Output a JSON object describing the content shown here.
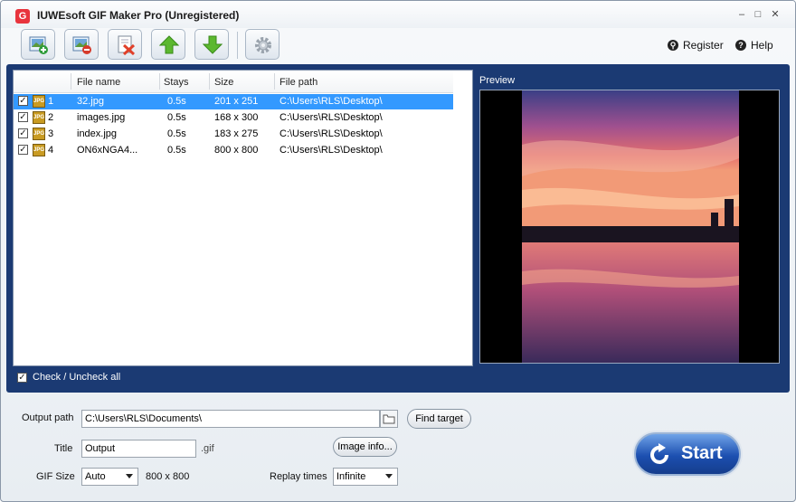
{
  "window": {
    "title": "IUWEsoft GIF Maker Pro (Unregistered)",
    "app_icon_letter": "G",
    "controls": [
      "–",
      "□",
      "✕"
    ]
  },
  "toolbar": {
    "buttons": [
      {
        "name": "add-image-button",
        "icon": "add-image-icon"
      },
      {
        "name": "remove-image-button",
        "icon": "remove-image-icon"
      },
      {
        "name": "clear-list-button",
        "icon": "delete-document-icon"
      },
      {
        "name": "move-up-button",
        "icon": "arrow-up-icon"
      },
      {
        "name": "move-down-button",
        "icon": "arrow-down-icon"
      },
      {
        "name": "settings-button",
        "icon": "gear-icon"
      }
    ],
    "register_label": "Register",
    "help_label": "Help"
  },
  "file_list": {
    "columns": [
      "File name",
      "Stays",
      "Size",
      "File path"
    ],
    "rows": [
      {
        "index": "1",
        "name": "32.jpg",
        "stays": "0.5s",
        "size": "201 x 251",
        "path": "C:\\Users\\RLS\\Desktop\\",
        "checked": true,
        "selected": true
      },
      {
        "index": "2",
        "name": "images.jpg",
        "stays": "0.5s",
        "size": "168 x 300",
        "path": "C:\\Users\\RLS\\Desktop\\",
        "checked": true,
        "selected": false
      },
      {
        "index": "3",
        "name": "index.jpg",
        "stays": "0.5s",
        "size": "183 x 275",
        "path": "C:\\Users\\RLS\\Desktop\\",
        "checked": true,
        "selected": false
      },
      {
        "index": "4",
        "name": "ON6xNGA4...",
        "stays": "0.5s",
        "size": "800 x 800",
        "path": "C:\\Users\\RLS\\Desktop\\",
        "checked": true,
        "selected": false
      }
    ],
    "check_all_label": "Check / Uncheck all",
    "icon_text": "JPG"
  },
  "preview": {
    "label": "Preview"
  },
  "output": {
    "path_label": "Output path",
    "path_value": "C:\\Users\\RLS\\Documents\\",
    "find_target_label": "Find target",
    "title_label": "Title",
    "title_value": "Output",
    "extension": ".gif",
    "image_info_label": "Image info...",
    "gif_size_label": "GIF Size",
    "gif_size_value": "Auto",
    "gif_dimensions": "800 x 800",
    "replay_label": "Replay times",
    "replay_value": "Infinite"
  },
  "start_label": "Start",
  "colors": {
    "panel": "#1b3a73",
    "selection": "#3399ff",
    "start_button": "#1c4fb0"
  }
}
